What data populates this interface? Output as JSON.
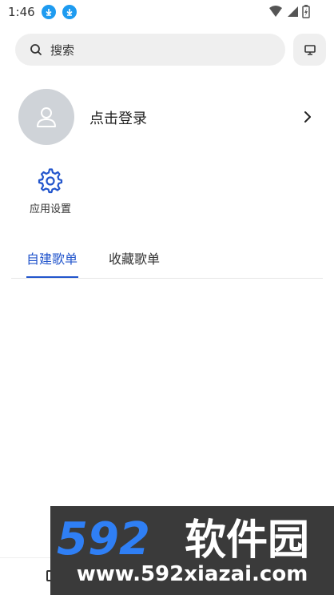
{
  "status_bar": {
    "time": "1:46"
  },
  "search": {
    "placeholder": "搜索"
  },
  "user": {
    "login_label": "点击登录"
  },
  "quick_actions": [
    {
      "label": "应用设置",
      "icon": "gear-icon"
    }
  ],
  "tabs": [
    {
      "label": "自建歌单",
      "active": true
    },
    {
      "label": "收藏歌单",
      "active": false
    }
  ],
  "watermark": {
    "brand": "592软件园",
    "url": "www.592xiazai.com"
  },
  "colors": {
    "accent": "#2255cc",
    "download_badge": "#1e9bf0",
    "avatar_bg": "#cfd3d8"
  }
}
